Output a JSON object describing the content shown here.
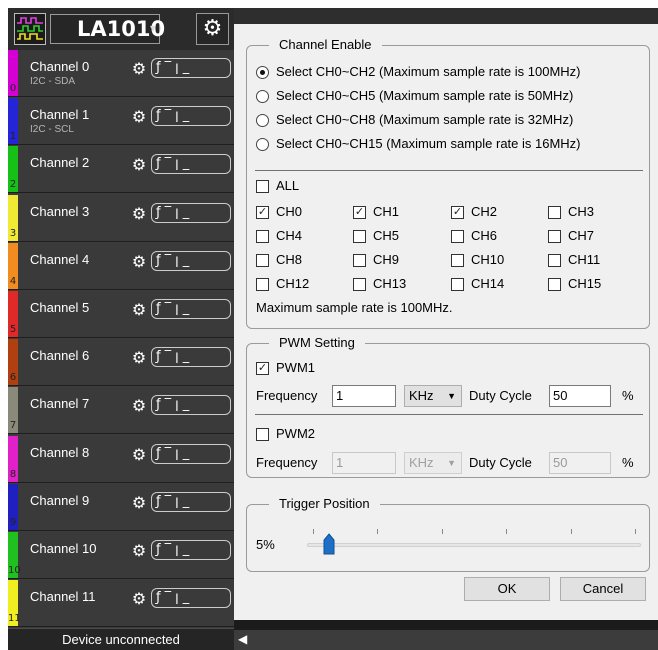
{
  "device": {
    "name": "LA1010",
    "status": "Device unconnected"
  },
  "channels": [
    {
      "label": "Channel 0",
      "sub": "I2C - SDA",
      "num": "0",
      "color": "#d400d4"
    },
    {
      "label": "Channel 1",
      "sub": "I2C - SCL",
      "num": "1",
      "color": "#2525d8"
    },
    {
      "label": "Channel 2",
      "sub": "",
      "num": "2",
      "color": "#17c017"
    },
    {
      "label": "Channel 3",
      "sub": "",
      "num": "3",
      "color": "#f0ea35"
    },
    {
      "label": "Channel 4",
      "sub": "",
      "num": "4",
      "color": "#f08c20"
    },
    {
      "label": "Channel 5",
      "sub": "",
      "num": "5",
      "color": "#e02a2a"
    },
    {
      "label": "Channel 6",
      "sub": "",
      "num": "6",
      "color": "#b04010"
    },
    {
      "label": "Channel 7",
      "sub": "",
      "num": "7",
      "color": "#8a8a7a"
    },
    {
      "label": "Channel 8",
      "sub": "",
      "num": "8",
      "color": "#e020c8"
    },
    {
      "label": "Channel 9",
      "sub": "",
      "num": "9",
      "color": "#2020c0"
    },
    {
      "label": "Channel 10",
      "sub": "",
      "num": "10",
      "color": "#20c020"
    },
    {
      "label": "Channel 11",
      "sub": "",
      "num": "11",
      "color": "#f0ee20"
    }
  ],
  "trigger_glyphs": "ƒ‾ꞁ_",
  "channel_enable": {
    "title": "Channel Enable",
    "options": [
      "Select CH0~CH2 (Maximum sample rate is 100MHz)",
      "Select CH0~CH5 (Maximum sample rate is 50MHz)",
      "Select CH0~CH8 (Maximum sample rate is 32MHz)",
      "Select CH0~CH15 (Maximum sample rate is 16MHz)"
    ],
    "selected_option": 0,
    "all_label": "ALL",
    "channels": [
      "CH0",
      "CH1",
      "CH2",
      "CH3",
      "CH4",
      "CH5",
      "CH6",
      "CH7",
      "CH8",
      "CH9",
      "CH10",
      "CH11",
      "CH12",
      "CH13",
      "CH14",
      "CH15"
    ],
    "checked": [
      true,
      true,
      true,
      false,
      false,
      false,
      false,
      false,
      false,
      false,
      false,
      false,
      false,
      false,
      false,
      false
    ],
    "info": "Maximum sample rate is 100MHz."
  },
  "pwm": {
    "title": "PWM Setting",
    "pwm1": {
      "label": "PWM1",
      "checked": true,
      "freq_label": "Frequency",
      "freq": "1",
      "unit": "KHz",
      "duty_label": "Duty Cycle",
      "duty": "50",
      "pct": "%"
    },
    "pwm2": {
      "label": "PWM2",
      "checked": false,
      "freq_label": "Frequency",
      "freq": "1",
      "unit": "KHz",
      "duty_label": "Duty Cycle",
      "duty": "50",
      "pct": "%"
    }
  },
  "trigger": {
    "title": "Trigger Position",
    "value": "5%",
    "position_percent": 5
  },
  "buttons": {
    "ok": "OK",
    "cancel": "Cancel"
  },
  "colors": {
    "panel": "#3a3a3a",
    "dialog": "#f0f0f0",
    "slider_thumb": "#1c6fc4"
  }
}
